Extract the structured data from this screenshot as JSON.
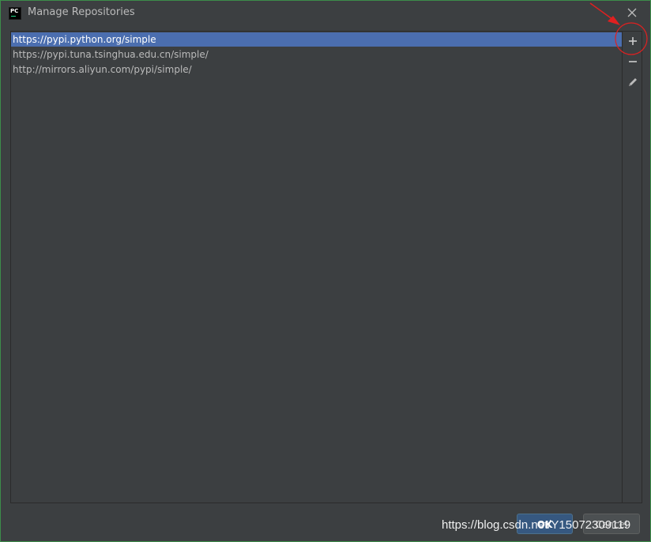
{
  "window": {
    "title": "Manage Repositories",
    "logo_text": "PC"
  },
  "repositories": [
    {
      "url": "https://pypi.python.org/simple",
      "selected": true
    },
    {
      "url": "https://pypi.tuna.tsinghua.edu.cn/simple/",
      "selected": false
    },
    {
      "url": "http://mirrors.aliyun.com/pypi/simple/",
      "selected": false
    }
  ],
  "toolbar": {
    "add_icon": "plus-icon",
    "remove_icon": "minus-icon",
    "edit_icon": "pencil-icon"
  },
  "buttons": {
    "ok_label": "OK",
    "cancel_label": "Cancel"
  },
  "watermark": {
    "text": "https://blog.csdn.net/Y15072309119"
  },
  "annotation": {
    "color": "#e02020",
    "target": "add-button"
  },
  "colors": {
    "background": "#3c3f41",
    "selection": "#4b6eaf",
    "ok_button": "#365880",
    "window_border": "#3c8c4a"
  }
}
